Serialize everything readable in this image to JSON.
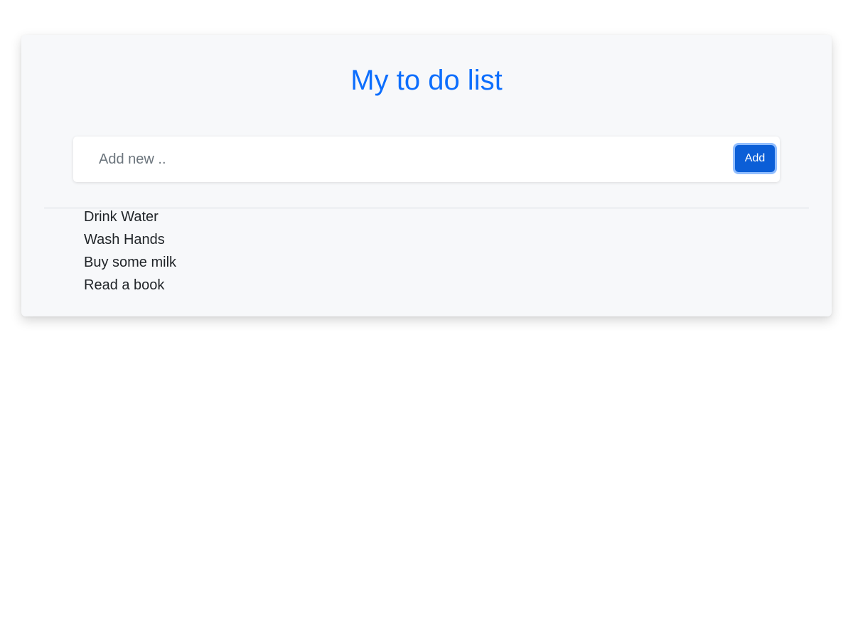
{
  "header": {
    "title": "My to do list"
  },
  "new_item": {
    "placeholder": "Add new ..",
    "value": "",
    "add_label": "Add"
  },
  "todos": [
    {
      "text": "Drink Water"
    },
    {
      "text": "Wash Hands"
    },
    {
      "text": "Buy some milk"
    },
    {
      "text": "Read a book"
    }
  ],
  "colors": {
    "accent": "#0d6efd",
    "button": "#0b5ed7",
    "card_background": "#f7f8fa",
    "text": "#212529",
    "placeholder": "#6c757d"
  }
}
